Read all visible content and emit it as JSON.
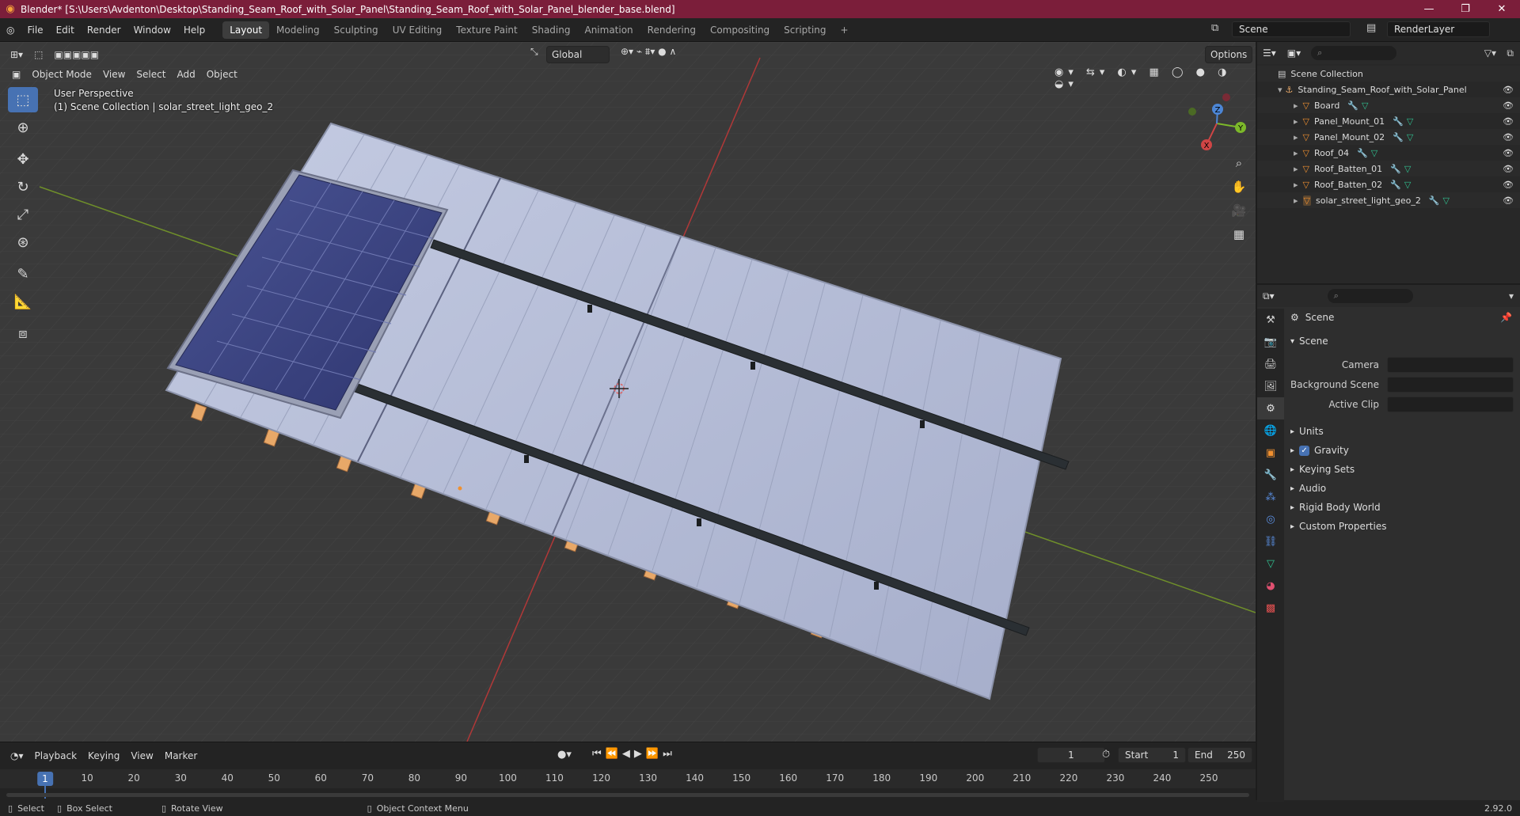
{
  "window": {
    "title": "Blender* [S:\\Users\\Avdenton\\Desktop\\Standing_Seam_Roof_with_Solar_Panel\\Standing_Seam_Roof_with_Solar_Panel_blender_base.blend]"
  },
  "menu": [
    "File",
    "Edit",
    "Render",
    "Window",
    "Help"
  ],
  "workspaces": [
    "Layout",
    "Modeling",
    "Sculpting",
    "UV Editing",
    "Texture Paint",
    "Shading",
    "Animation",
    "Rendering",
    "Compositing",
    "Scripting"
  ],
  "active_workspace": "Layout",
  "scene_name": "Scene",
  "render_layer": "RenderLayer",
  "viewport": {
    "mode": "Object Mode",
    "menus": [
      "View",
      "Select",
      "Add",
      "Object"
    ],
    "transform_orientation": "Global",
    "options_label": "Options",
    "perspective_label": "User Perspective",
    "collection_label": "(1) Scene Collection | solar_street_light_geo_2",
    "gizmo_axes": {
      "x": "X",
      "y": "Y",
      "z": "Z"
    }
  },
  "outliner": {
    "root": "Scene Collection",
    "collection": "Standing_Seam_Roof_with_Solar_Panel",
    "objects": [
      "Board",
      "Panel_Mount_01",
      "Panel_Mount_02",
      "Roof_04",
      "Roof_Batten_01",
      "Roof_Batten_02",
      "solar_street_light_geo_2"
    ]
  },
  "properties": {
    "context_title": "Scene",
    "panel_title": "Scene",
    "fields": [
      {
        "label": "Camera"
      },
      {
        "label": "Background Scene"
      },
      {
        "label": "Active Clip"
      }
    ],
    "panels": [
      "Units",
      "Gravity",
      "Keying Sets",
      "Audio",
      "Rigid Body World",
      "Custom Properties"
    ],
    "gravity_checked": true
  },
  "timeline": {
    "menus": [
      "Playback",
      "Keying",
      "View",
      "Marker"
    ],
    "current_frame": "1",
    "start_label": "Start",
    "start": "1",
    "end_label": "End",
    "end": "250",
    "ticks": [
      "1",
      "10",
      "20",
      "30",
      "40",
      "50",
      "60",
      "70",
      "80",
      "90",
      "100",
      "110",
      "120",
      "130",
      "140",
      "150",
      "160",
      "170",
      "180",
      "190",
      "200",
      "210",
      "220",
      "230",
      "240",
      "250"
    ]
  },
  "statusbar": {
    "select": "Select",
    "box_select": "Box Select",
    "rotate_view": "Rotate View",
    "context_menu": "Object Context Menu",
    "version": "2.92.0"
  },
  "colors": {
    "title_bar": "#7b1e3a",
    "accent": "#4772b3",
    "roof": "#b8c0d8",
    "panel": "#3a4275",
    "rail": "#2a2f33",
    "batten": "#e8a868"
  }
}
